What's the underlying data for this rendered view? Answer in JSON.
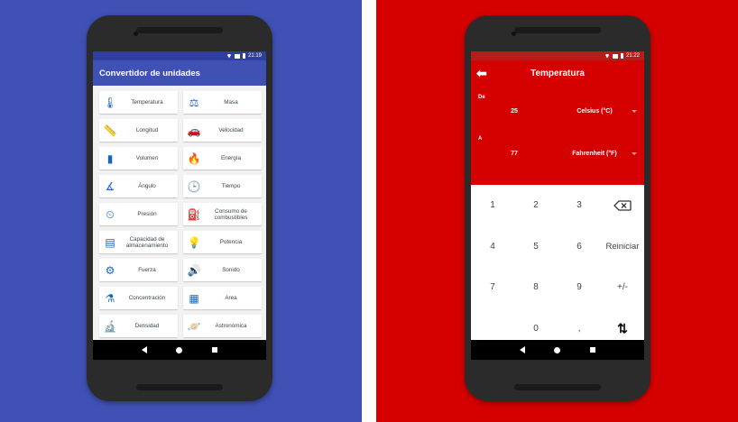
{
  "left": {
    "status_time": "21:19",
    "app_title": "Convertidor de unidades",
    "categories": [
      {
        "label": "Temperatura",
        "icon": "thermometer-icon"
      },
      {
        "label": "Masa",
        "icon": "scale-icon"
      },
      {
        "label": "Longitud",
        "icon": "ruler-icon"
      },
      {
        "label": "Velocidad",
        "icon": "car-icon"
      },
      {
        "label": "Volumen",
        "icon": "barrel-icon"
      },
      {
        "label": "Energía",
        "icon": "flame-icon"
      },
      {
        "label": "Ángulo",
        "icon": "compass-icon"
      },
      {
        "label": "Tiempo",
        "icon": "clock-icon"
      },
      {
        "label": "Presión",
        "icon": "pressure-gauge-icon"
      },
      {
        "label": "Consumo de combustibles",
        "icon": "fuel-pump-icon"
      },
      {
        "label": "Capacidad de almacenamiento",
        "icon": "storage-icon"
      },
      {
        "label": "Potencia",
        "icon": "lightbulb-icon"
      },
      {
        "label": "Fuerza",
        "icon": "force-icon"
      },
      {
        "label": "Sonido",
        "icon": "sound-icon"
      },
      {
        "label": "Concentración",
        "icon": "flask-icon"
      },
      {
        "label": "Area",
        "icon": "area-icon"
      },
      {
        "label": "Densidad",
        "icon": "microscope-icon"
      },
      {
        "label": "Astronómica",
        "icon": "planet-icon"
      }
    ]
  },
  "right": {
    "status_time": "21:22",
    "title": "Temperatura",
    "from_label": "De",
    "from_value": "25",
    "from_unit": "Celsius (°C)",
    "to_label": "A",
    "to_value": "77",
    "to_unit": "Fahrenheit (°F)",
    "keys": {
      "k1": "1",
      "k2": "2",
      "k3": "3",
      "k4": "4",
      "k5": "5",
      "k6": "6",
      "reset": "Reiniciar",
      "k7": "7",
      "k8": "8",
      "k9": "9",
      "sign": "+/-",
      "k0": "0",
      "dot": ","
    }
  },
  "colors": {
    "left_background": "#3f51b5",
    "right_background": "#d50000",
    "accent_blue": "#1565c0"
  }
}
